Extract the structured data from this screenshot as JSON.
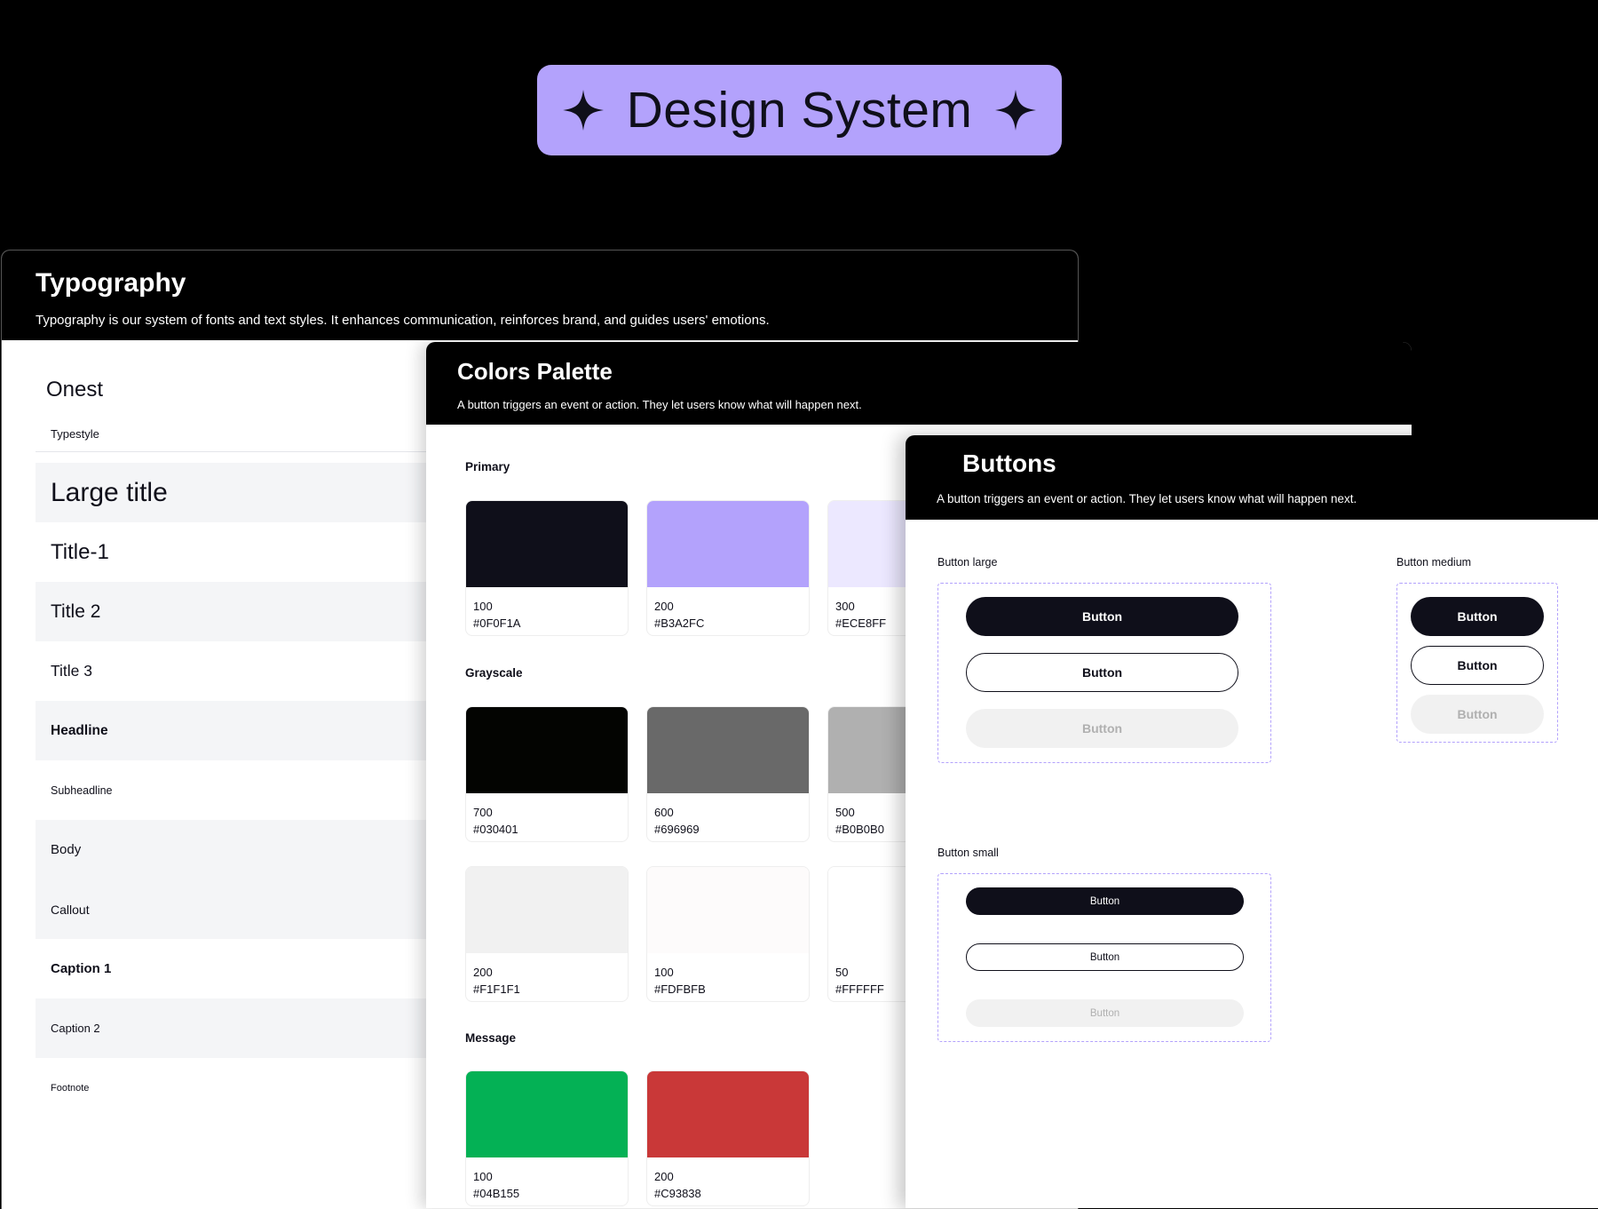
{
  "hero": {
    "title": "Design System",
    "bg": "#B3A2FC",
    "icon": "sparkle-icon"
  },
  "typography": {
    "title": "Typography",
    "description": "Typography is our system of fonts and text styles. It enhances communication, reinforces brand, and guides users' emotions.",
    "font_name": "Onest",
    "column_label": "Typestyle",
    "styles": [
      {
        "label": "Large title"
      },
      {
        "label": "Title-1"
      },
      {
        "label": "Title 2"
      },
      {
        "label": "Title 3"
      },
      {
        "label": "Headline"
      },
      {
        "label": "Subheadline"
      },
      {
        "label": "Body"
      },
      {
        "label": "Callout"
      },
      {
        "label": "Caption 1"
      },
      {
        "label": "Caption 2"
      },
      {
        "label": "Footnote"
      }
    ]
  },
  "colors": {
    "title": "Colors Palette",
    "description": "A button triggers an event or action. They let users know what will happen next.",
    "sections": {
      "primary": {
        "label": "Primary",
        "swatches": [
          {
            "weight": "100",
            "hex": "#0F0F1A",
            "hex_label": "#0F0F1A"
          },
          {
            "weight": "200",
            "hex": "#B3A2FC",
            "hex_label": "#B3A2FC"
          },
          {
            "weight": "300",
            "hex": "#ECE8FF",
            "hex_label": "#ECE8FF"
          }
        ]
      },
      "grayscale": {
        "label": "Grayscale",
        "swatches": [
          {
            "weight": "700",
            "hex": "#030401",
            "hex_label": "#030401"
          },
          {
            "weight": "600",
            "hex": "#696969",
            "hex_label": "#696969"
          },
          {
            "weight": "500",
            "hex": "#B0B0B0",
            "hex_label": "#B0B0B0"
          },
          {
            "weight": "200",
            "hex": "#F1F1F1",
            "hex_label": "#F1F1F1"
          },
          {
            "weight": "100",
            "hex": "#FDFBFB",
            "hex_label": "#FDFBFB"
          },
          {
            "weight": "50",
            "hex": "#FFFFFF",
            "hex_label": "#FFFFFF"
          }
        ]
      },
      "message": {
        "label": "Message",
        "swatches": [
          {
            "weight": "100",
            "hex": "#04B155",
            "hex_label": "#04B155"
          },
          {
            "weight": "200",
            "hex": "#C93838",
            "hex_label": "#C93838"
          }
        ]
      }
    }
  },
  "buttons": {
    "title": "Buttons",
    "description": "A button triggers an event or action. They let users know what will happen next.",
    "large": {
      "label": "Button large",
      "primary": "Button",
      "secondary": "Button",
      "disabled": "Button"
    },
    "medium": {
      "label": "Button medium",
      "primary": "Button",
      "secondary": "Button",
      "disabled": "Button"
    },
    "small": {
      "label": "Button small",
      "primary": "Button",
      "secondary": "Button",
      "disabled": "Button"
    },
    "accent": "#B3A2FC"
  }
}
